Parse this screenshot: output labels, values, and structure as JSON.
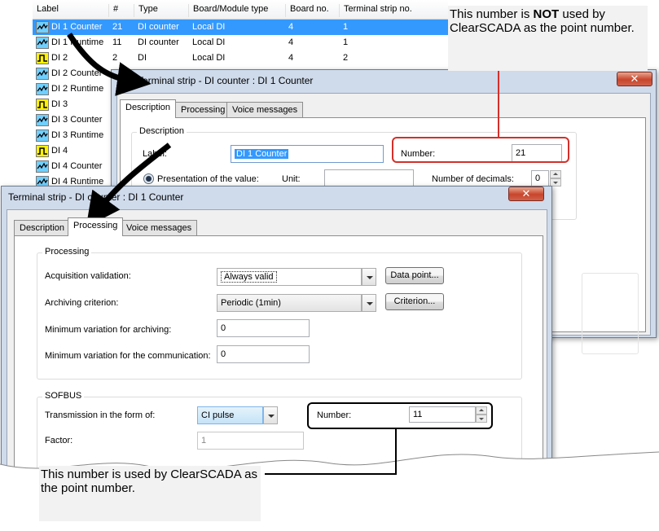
{
  "list": {
    "columns": [
      "Label",
      "#",
      "Type",
      "Board/Module type",
      "Board no.",
      "Terminal strip no."
    ],
    "rows": [
      {
        "icon": "analog-signal-icon",
        "label": "DI 1 Counter",
        "num": "21",
        "type": "DI counter",
        "board_type": "Local DI",
        "board_no": "4",
        "strip_no": "1",
        "selected": true
      },
      {
        "icon": "analog-signal-icon",
        "label": "DI 1 Runtime",
        "num": "11",
        "type": "DI counter",
        "board_type": "Local DI",
        "board_no": "4",
        "strip_no": "1"
      },
      {
        "icon": "digital-signal-icon",
        "label": "DI 2",
        "num": "2",
        "type": "DI",
        "board_type": "Local DI",
        "board_no": "4",
        "strip_no": "2"
      },
      {
        "icon": "analog-signal-icon",
        "label": "DI 2 Counter"
      },
      {
        "icon": "analog-signal-icon",
        "label": "DI 2 Runtime"
      },
      {
        "icon": "digital-signal-icon",
        "label": "DI 3"
      },
      {
        "icon": "analog-signal-icon",
        "label": "DI 3 Counter"
      },
      {
        "icon": "analog-signal-icon",
        "label": "DI 3 Runtime"
      },
      {
        "icon": "digital-signal-icon",
        "label": "DI 4"
      },
      {
        "icon": "analog-signal-icon",
        "label": "DI 4 Counter"
      },
      {
        "icon": "analog-signal-icon",
        "label": "DI 4 Runtime"
      }
    ]
  },
  "back_window": {
    "title": "Terminal strip - DI counter : DI 1 Counter",
    "tabs": [
      "Description",
      "Processing",
      "Voice messages"
    ],
    "active_tab": "Description",
    "group_title": "Description",
    "label_label": "Label:",
    "label_value": "DI 1 Counter",
    "number_label": "Number:",
    "number_value": "21",
    "presentation_label": "Presentation of the value:",
    "unit_label": "Unit:",
    "unit_value": "",
    "decimals_label": "Number of decimals:",
    "decimals_value": "0"
  },
  "front_window": {
    "title": "Terminal strip - DI counter : DI 1 Counter",
    "tabs": [
      "Description",
      "Processing",
      "Voice messages"
    ],
    "active_tab": "Processing",
    "processing": {
      "group_title": "Processing",
      "acq_label": "Acquisition validation:",
      "acq_value": "Always valid",
      "data_point_button": "Data point...",
      "arch_label": "Archiving criterion:",
      "arch_value": "Periodic (1min)",
      "criterion_button": "Criterion...",
      "minvar_arch_label": "Minimum variation for archiving:",
      "minvar_arch_value": "0",
      "minvar_comm_label": "Minimum variation for the communication:",
      "minvar_comm_value": "0"
    },
    "sofbus": {
      "group_title": "SOFBUS",
      "transmission_label": "Transmission in the form of:",
      "transmission_value": "CI pulse",
      "number_label": "Number:",
      "number_value": "11",
      "factor_label": "Factor:",
      "factor_value": "1"
    }
  },
  "callouts": {
    "top_note_pre": "This number is ",
    "top_note_bold": "NOT",
    "top_note_post": " used by ClearSCADA as the point number.",
    "bottom_note": "This number is used by ClearSCADA as the point number.",
    "top_box_color": "#d3302a",
    "bottom_box_color": "#000000"
  }
}
